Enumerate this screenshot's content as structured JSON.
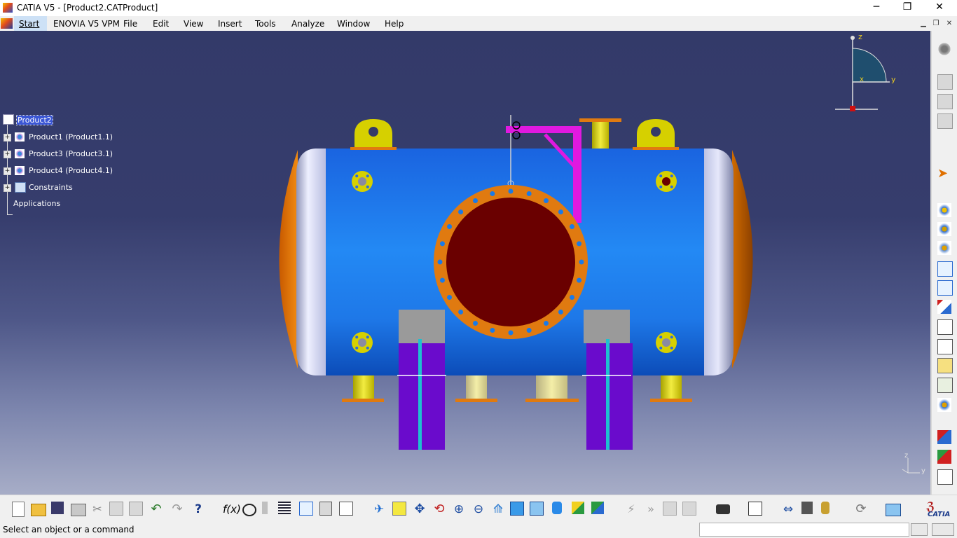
{
  "window": {
    "title": "CATIA V5 - [Product2.CATProduct]",
    "minimize_glyph": "─",
    "maximize_glyph": "❐",
    "close_glyph": "✕"
  },
  "menu": {
    "items": [
      "Start",
      "ENOVIA V5 VPM",
      "File",
      "Edit",
      "View",
      "Insert",
      "Tools",
      "Analyze",
      "Window",
      "Help"
    ],
    "doc_min_glyph": "▁",
    "doc_restore_glyph": "❐",
    "doc_close_glyph": "✕"
  },
  "tree": {
    "root": "Product2",
    "children": [
      "Product1 (Product1.1)",
      "Product3 (Product3.1)",
      "Product4 (Product4.1)",
      "Constraints"
    ],
    "applications": "Applications"
  },
  "compass": {
    "z": "z",
    "y": "y",
    "x": "x"
  },
  "axis_triad": {
    "z": "z",
    "y": "y"
  },
  "right_toolbar": {
    "icons": [
      "gear-settings-icon",
      "clipboard-icon",
      "clipboard-icon",
      "clipboard-icon",
      "select-arrow-icon",
      "new-component-icon",
      "new-product-icon",
      "new-part-icon",
      "existing-component-icon",
      "replace-component-icon",
      "graph-tree-reorder-icon",
      "generate-numbering-icon",
      "bill-of-material-icon",
      "fix-icon",
      "manipulation-icon",
      "explode-icon",
      "multi-instantiation-icon",
      "publication-icon",
      "stop-manipulation-icon",
      "snap-icon"
    ]
  },
  "bottom_toolbar": {
    "icons": [
      "new-icon",
      "open-icon",
      "save-icon",
      "print-icon",
      "cut-icon",
      "copy-icon",
      "paste-icon",
      "undo-icon",
      "redo-icon",
      "whats-this-icon",
      "formula-icon",
      "knowledge-advisor-icon",
      "measure-icon",
      "catalog-icon",
      "product-structure-icon",
      "lock-icon",
      "hide-icon",
      "fly-mode-icon",
      "fit-all-icon",
      "pan-icon",
      "rotate-icon",
      "zoom-in-icon",
      "zoom-out-icon",
      "normal-view-icon",
      "multi-view-icon",
      "iso-view-icon",
      "shading-icon",
      "hide-show-icon",
      "swap-visible-icon",
      "clash-icon",
      "sectioning-icon",
      "distance-icon",
      "camera-icon",
      "update-icon",
      "constraint-icon",
      "component-icon",
      "publish-icon",
      "refresh-icon",
      "sketch-icon"
    ],
    "brand": "CATIA"
  },
  "status": {
    "message": "Select an object or a command"
  },
  "colors": {
    "background_top": "#333a69",
    "background_bottom": "#a7adc7",
    "vessel_body": "#1e73e8",
    "vessel_cap": "#c8c8e0",
    "vessel_end": "#e07a10",
    "manway_flange": "#e07a10",
    "manway_inner": "#6a0000",
    "nozzle": "#d6d000",
    "lifting_lug": "#d6d000",
    "pipe": "#e019e0",
    "saddle": "#6a0bcc",
    "saddle_top": "#9a9a9a",
    "selection": "#3b57d6"
  }
}
